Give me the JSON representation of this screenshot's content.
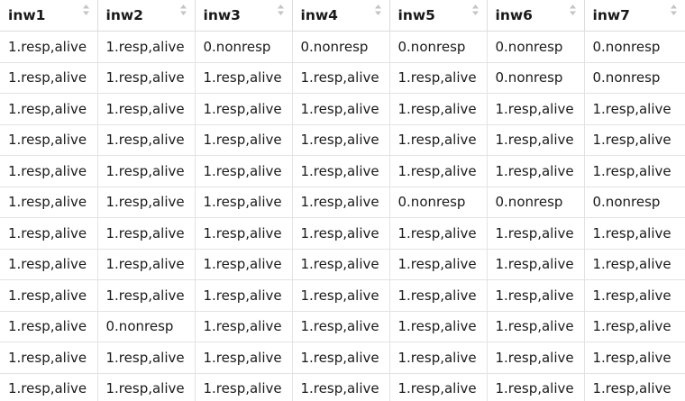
{
  "table": {
    "columns": [
      "inw1",
      "inw2",
      "inw3",
      "inw4",
      "inw5",
      "inw6",
      "inw7"
    ],
    "rows": [
      [
        "1.resp,alive",
        "1.resp,alive",
        "0.nonresp",
        "0.nonresp",
        "0.nonresp",
        "0.nonresp",
        "0.nonresp"
      ],
      [
        "1.resp,alive",
        "1.resp,alive",
        "1.resp,alive",
        "1.resp,alive",
        "1.resp,alive",
        "0.nonresp",
        "0.nonresp"
      ],
      [
        "1.resp,alive",
        "1.resp,alive",
        "1.resp,alive",
        "1.resp,alive",
        "1.resp,alive",
        "1.resp,alive",
        "1.resp,alive"
      ],
      [
        "1.resp,alive",
        "1.resp,alive",
        "1.resp,alive",
        "1.resp,alive",
        "1.resp,alive",
        "1.resp,alive",
        "1.resp,alive"
      ],
      [
        "1.resp,alive",
        "1.resp,alive",
        "1.resp,alive",
        "1.resp,alive",
        "1.resp,alive",
        "1.resp,alive",
        "1.resp,alive"
      ],
      [
        "1.resp,alive",
        "1.resp,alive",
        "1.resp,alive",
        "1.resp,alive",
        "0.nonresp",
        "0.nonresp",
        "0.nonresp"
      ],
      [
        "1.resp,alive",
        "1.resp,alive",
        "1.resp,alive",
        "1.resp,alive",
        "1.resp,alive",
        "1.resp,alive",
        "1.resp,alive"
      ],
      [
        "1.resp,alive",
        "1.resp,alive",
        "1.resp,alive",
        "1.resp,alive",
        "1.resp,alive",
        "1.resp,alive",
        "1.resp,alive"
      ],
      [
        "1.resp,alive",
        "1.resp,alive",
        "1.resp,alive",
        "1.resp,alive",
        "1.resp,alive",
        "1.resp,alive",
        "1.resp,alive"
      ],
      [
        "1.resp,alive",
        "0.nonresp",
        "1.resp,alive",
        "1.resp,alive",
        "1.resp,alive",
        "1.resp,alive",
        "1.resp,alive"
      ],
      [
        "1.resp,alive",
        "1.resp,alive",
        "1.resp,alive",
        "1.resp,alive",
        "1.resp,alive",
        "1.resp,alive",
        "1.resp,alive"
      ],
      [
        "1.resp,alive",
        "1.resp,alive",
        "1.resp,alive",
        "1.resp,alive",
        "1.resp,alive",
        "1.resp,alive",
        "1.resp,alive"
      ]
    ],
    "sort_icon": "sort-updown-icon"
  },
  "colors": {
    "border": "#dcdcdc",
    "text": "#1a1a1a",
    "sort_icon": "#c4c4c4"
  }
}
